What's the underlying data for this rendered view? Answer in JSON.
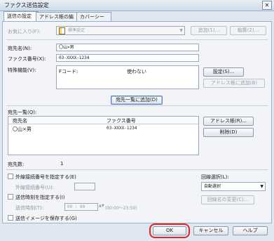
{
  "window": {
    "title": "ファクス送信設定",
    "close_glyph": "✕"
  },
  "tabs": [
    {
      "label": "送信の設定"
    },
    {
      "label": "アドレス帳の編集"
    },
    {
      "label": "カバーシート"
    }
  ],
  "favorites": {
    "label": "お気に入り(F):",
    "value": "標準設定",
    "add_button": "追加(1)...",
    "edit_button": "編集(2)..."
  },
  "recipient": {
    "name_label": "宛先名(N):",
    "name_value": "〇山×男",
    "fax_label": "ファクス番号(X):",
    "fax_value": "03-XXXX-1234",
    "special_label": "特殊機能(V):",
    "special_col1": "Fコード:",
    "special_col2": "使わない",
    "settings_button": "設定(S)...",
    "add_to_addressbook_button": "アドレス帳に追加(B)",
    "add_to_list_button": "宛先一覧に追加(D)"
  },
  "dest_list": {
    "label": "宛先一覧(Q):",
    "columns": [
      "宛先名",
      "ファクス番号"
    ],
    "rows": [
      {
        "name": "〇山×男",
        "fax": "03-XXXX-1234"
      }
    ],
    "addressbook_button": "アドレス帳(R)...",
    "delete_button": "削除(D)",
    "count_label": "宛先数:",
    "count_value": "1"
  },
  "options": {
    "outside_line_label": "外線接続番号を指定する(E)",
    "outside_number_label": "外線接続番号(U):",
    "send_time_label": "送信時刻を指定する(I)",
    "send_time_field_label": "送信時刻(T):",
    "send_time_value": "00 : 00",
    "send_time_range": "(00:00〜23:59)",
    "save_image_label": "送信イメージを保存する(G)",
    "line_select_label": "回線選択(L):",
    "line_select_value": "自動選択",
    "line_name_button": "回線名の変更(C)..."
  },
  "footer": {
    "ok": "OK",
    "cancel": "キャンセル",
    "help": "ヘルプ"
  },
  "colors": {
    "highlight_ring": "#e0262c"
  }
}
